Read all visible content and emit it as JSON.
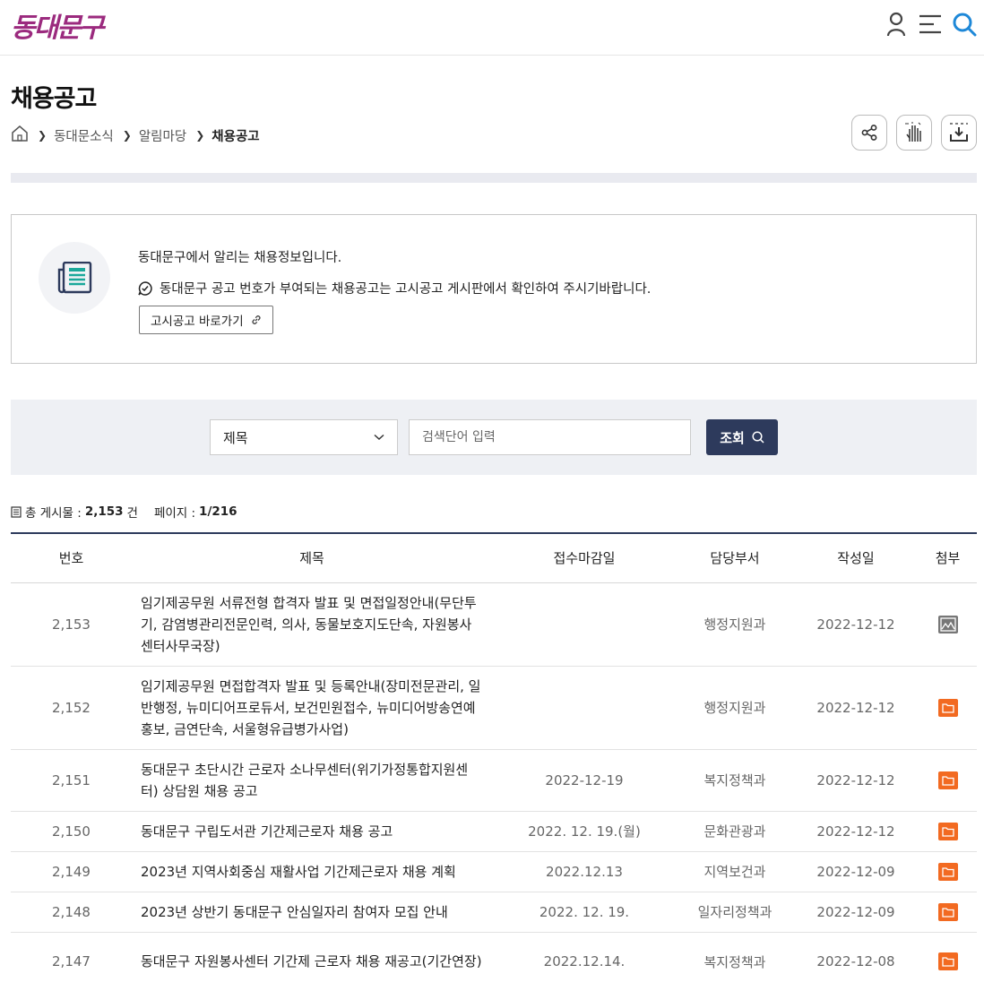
{
  "header": {
    "logo_text": "동대문구",
    "icons": [
      "user-icon",
      "menu-icon",
      "search-icon"
    ]
  },
  "page": {
    "title": "채용공고",
    "breadcrumb": [
      "동대문소식",
      "알림마당",
      "채용공고"
    ]
  },
  "tools": [
    "share-icon",
    "gesture-icon",
    "download-icon"
  ],
  "info": {
    "line1": "동대문구에서 알리는 채용정보입니다.",
    "line2": "동대문구 공고 번호가 부여되는 채용공고는 고시공고 게시판에서 확인하여 주시기바랍니다.",
    "goto_label": "고시공고 바로가기"
  },
  "search": {
    "select_value": "제목",
    "placeholder": "검색단어 입력",
    "button_label": "조회"
  },
  "counts": {
    "total_label": "총 게시물 :",
    "total_value": "2,153",
    "total_unit": "건",
    "page_label": "페이지 :",
    "page_value": "1/216"
  },
  "table": {
    "headers": [
      "번호",
      "제목",
      "접수마감일",
      "담당부서",
      "작성일",
      "첨부"
    ],
    "rows": [
      {
        "no": "2,153",
        "title": "임기제공무원 서류전형 합격자 발표 및 면접일정안내(무단투기, 감염병관리전문인력, 의사, 동물보호지도단속, 자원봉사센터사무국장)",
        "deadline": "",
        "dept": "행정지원과",
        "date": "2022-12-12",
        "attach": "image"
      },
      {
        "no": "2,152",
        "title": "임기제공무원 면접합격자 발표 및 등록안내(장미전문관리, 일반행정, 뉴미디어프로듀서, 보건민원접수, 뉴미디어방송연예홍보, 금연단속, 서울형유급병가사업)",
        "deadline": "",
        "dept": "행정지원과",
        "date": "2022-12-12",
        "attach": "file"
      },
      {
        "no": "2,151",
        "title": "동대문구 초단시간 근로자 소나무센터(위기가정통합지원센터) 상담원 채용 공고",
        "deadline": "2022-12-19",
        "dept": "복지정책과",
        "date": "2022-12-12",
        "attach": "file"
      },
      {
        "no": "2,150",
        "title": "동대문구 구립도서관 기간제근로자 채용 공고",
        "deadline": "2022. 12. 19.(월)",
        "dept": "문화관광과",
        "date": "2022-12-12",
        "attach": "file"
      },
      {
        "no": "2,149",
        "title": "2023년 지역사회중심 재활사업 기간제근로자 채용 계획",
        "deadline": "2022.12.13",
        "dept": "지역보건과",
        "date": "2022-12-09",
        "attach": "file"
      },
      {
        "no": "2,148",
        "title": "2023년 상반기 동대문구 안심일자리 참여자 모집 안내",
        "deadline": "2022. 12. 19.",
        "dept": "일자리정책과",
        "date": "2022-12-09",
        "attach": "file"
      },
      {
        "no": "2,147",
        "title": "동대문구 자원봉사센터 기간제 근로자 채용 재공고(기간연장)",
        "deadline": "2022.12.14.",
        "dept": "복지정책과",
        "date": "2022-12-08",
        "attach": "file"
      }
    ]
  }
}
